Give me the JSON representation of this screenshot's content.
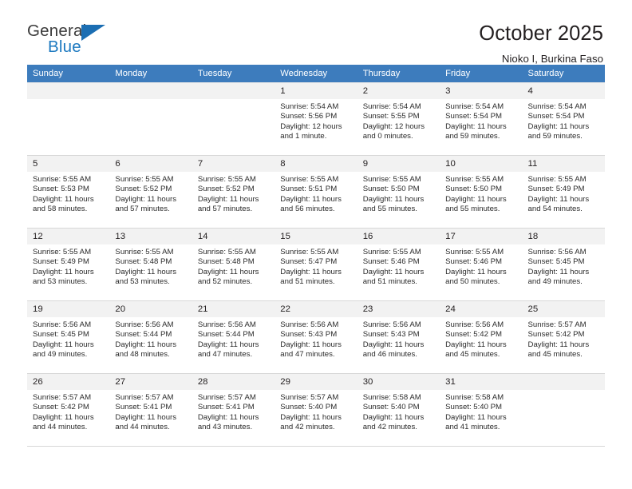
{
  "brand": {
    "name_part1": "General",
    "name_part2": "Blue",
    "triangle_color": "#1b6eb3",
    "blue_text_color": "#1c79c0"
  },
  "header": {
    "title": "October 2025",
    "subtitle": "Nioko I, Burkina Faso",
    "header_bg_color": "#3d7cbd",
    "daynum_bg_color": "#f2f2f2"
  },
  "weekdays": [
    "Sunday",
    "Monday",
    "Tuesday",
    "Wednesday",
    "Thursday",
    "Friday",
    "Saturday"
  ],
  "labels": {
    "sunrise": "Sunrise:",
    "sunset": "Sunset:",
    "daylight": "Daylight:"
  },
  "weeks": [
    [
      {
        "day": "",
        "empty": true
      },
      {
        "day": "",
        "empty": true
      },
      {
        "day": "",
        "empty": true
      },
      {
        "day": "1",
        "sunrise": "Sunrise: 5:54 AM",
        "sunset": "Sunset: 5:56 PM",
        "daylight1": "Daylight: 12 hours",
        "daylight2": "and 1 minute."
      },
      {
        "day": "2",
        "sunrise": "Sunrise: 5:54 AM",
        "sunset": "Sunset: 5:55 PM",
        "daylight1": "Daylight: 12 hours",
        "daylight2": "and 0 minutes."
      },
      {
        "day": "3",
        "sunrise": "Sunrise: 5:54 AM",
        "sunset": "Sunset: 5:54 PM",
        "daylight1": "Daylight: 11 hours",
        "daylight2": "and 59 minutes."
      },
      {
        "day": "4",
        "sunrise": "Sunrise: 5:54 AM",
        "sunset": "Sunset: 5:54 PM",
        "daylight1": "Daylight: 11 hours",
        "daylight2": "and 59 minutes."
      }
    ],
    [
      {
        "day": "5",
        "sunrise": "Sunrise: 5:55 AM",
        "sunset": "Sunset: 5:53 PM",
        "daylight1": "Daylight: 11 hours",
        "daylight2": "and 58 minutes."
      },
      {
        "day": "6",
        "sunrise": "Sunrise: 5:55 AM",
        "sunset": "Sunset: 5:52 PM",
        "daylight1": "Daylight: 11 hours",
        "daylight2": "and 57 minutes."
      },
      {
        "day": "7",
        "sunrise": "Sunrise: 5:55 AM",
        "sunset": "Sunset: 5:52 PM",
        "daylight1": "Daylight: 11 hours",
        "daylight2": "and 57 minutes."
      },
      {
        "day": "8",
        "sunrise": "Sunrise: 5:55 AM",
        "sunset": "Sunset: 5:51 PM",
        "daylight1": "Daylight: 11 hours",
        "daylight2": "and 56 minutes."
      },
      {
        "day": "9",
        "sunrise": "Sunrise: 5:55 AM",
        "sunset": "Sunset: 5:50 PM",
        "daylight1": "Daylight: 11 hours",
        "daylight2": "and 55 minutes."
      },
      {
        "day": "10",
        "sunrise": "Sunrise: 5:55 AM",
        "sunset": "Sunset: 5:50 PM",
        "daylight1": "Daylight: 11 hours",
        "daylight2": "and 55 minutes."
      },
      {
        "day": "11",
        "sunrise": "Sunrise: 5:55 AM",
        "sunset": "Sunset: 5:49 PM",
        "daylight1": "Daylight: 11 hours",
        "daylight2": "and 54 minutes."
      }
    ],
    [
      {
        "day": "12",
        "sunrise": "Sunrise: 5:55 AM",
        "sunset": "Sunset: 5:49 PM",
        "daylight1": "Daylight: 11 hours",
        "daylight2": "and 53 minutes."
      },
      {
        "day": "13",
        "sunrise": "Sunrise: 5:55 AM",
        "sunset": "Sunset: 5:48 PM",
        "daylight1": "Daylight: 11 hours",
        "daylight2": "and 53 minutes."
      },
      {
        "day": "14",
        "sunrise": "Sunrise: 5:55 AM",
        "sunset": "Sunset: 5:48 PM",
        "daylight1": "Daylight: 11 hours",
        "daylight2": "and 52 minutes."
      },
      {
        "day": "15",
        "sunrise": "Sunrise: 5:55 AM",
        "sunset": "Sunset: 5:47 PM",
        "daylight1": "Daylight: 11 hours",
        "daylight2": "and 51 minutes."
      },
      {
        "day": "16",
        "sunrise": "Sunrise: 5:55 AM",
        "sunset": "Sunset: 5:46 PM",
        "daylight1": "Daylight: 11 hours",
        "daylight2": "and 51 minutes."
      },
      {
        "day": "17",
        "sunrise": "Sunrise: 5:55 AM",
        "sunset": "Sunset: 5:46 PM",
        "daylight1": "Daylight: 11 hours",
        "daylight2": "and 50 minutes."
      },
      {
        "day": "18",
        "sunrise": "Sunrise: 5:56 AM",
        "sunset": "Sunset: 5:45 PM",
        "daylight1": "Daylight: 11 hours",
        "daylight2": "and 49 minutes."
      }
    ],
    [
      {
        "day": "19",
        "sunrise": "Sunrise: 5:56 AM",
        "sunset": "Sunset: 5:45 PM",
        "daylight1": "Daylight: 11 hours",
        "daylight2": "and 49 minutes."
      },
      {
        "day": "20",
        "sunrise": "Sunrise: 5:56 AM",
        "sunset": "Sunset: 5:44 PM",
        "daylight1": "Daylight: 11 hours",
        "daylight2": "and 48 minutes."
      },
      {
        "day": "21",
        "sunrise": "Sunrise: 5:56 AM",
        "sunset": "Sunset: 5:44 PM",
        "daylight1": "Daylight: 11 hours",
        "daylight2": "and 47 minutes."
      },
      {
        "day": "22",
        "sunrise": "Sunrise: 5:56 AM",
        "sunset": "Sunset: 5:43 PM",
        "daylight1": "Daylight: 11 hours",
        "daylight2": "and 47 minutes."
      },
      {
        "day": "23",
        "sunrise": "Sunrise: 5:56 AM",
        "sunset": "Sunset: 5:43 PM",
        "daylight1": "Daylight: 11 hours",
        "daylight2": "and 46 minutes."
      },
      {
        "day": "24",
        "sunrise": "Sunrise: 5:56 AM",
        "sunset": "Sunset: 5:42 PM",
        "daylight1": "Daylight: 11 hours",
        "daylight2": "and 45 minutes."
      },
      {
        "day": "25",
        "sunrise": "Sunrise: 5:57 AM",
        "sunset": "Sunset: 5:42 PM",
        "daylight1": "Daylight: 11 hours",
        "daylight2": "and 45 minutes."
      }
    ],
    [
      {
        "day": "26",
        "sunrise": "Sunrise: 5:57 AM",
        "sunset": "Sunset: 5:42 PM",
        "daylight1": "Daylight: 11 hours",
        "daylight2": "and 44 minutes."
      },
      {
        "day": "27",
        "sunrise": "Sunrise: 5:57 AM",
        "sunset": "Sunset: 5:41 PM",
        "daylight1": "Daylight: 11 hours",
        "daylight2": "and 44 minutes."
      },
      {
        "day": "28",
        "sunrise": "Sunrise: 5:57 AM",
        "sunset": "Sunset: 5:41 PM",
        "daylight1": "Daylight: 11 hours",
        "daylight2": "and 43 minutes."
      },
      {
        "day": "29",
        "sunrise": "Sunrise: 5:57 AM",
        "sunset": "Sunset: 5:40 PM",
        "daylight1": "Daylight: 11 hours",
        "daylight2": "and 42 minutes."
      },
      {
        "day": "30",
        "sunrise": "Sunrise: 5:58 AM",
        "sunset": "Sunset: 5:40 PM",
        "daylight1": "Daylight: 11 hours",
        "daylight2": "and 42 minutes."
      },
      {
        "day": "31",
        "sunrise": "Sunrise: 5:58 AM",
        "sunset": "Sunset: 5:40 PM",
        "daylight1": "Daylight: 11 hours",
        "daylight2": "and 41 minutes."
      },
      {
        "day": "",
        "empty": true
      }
    ]
  ]
}
